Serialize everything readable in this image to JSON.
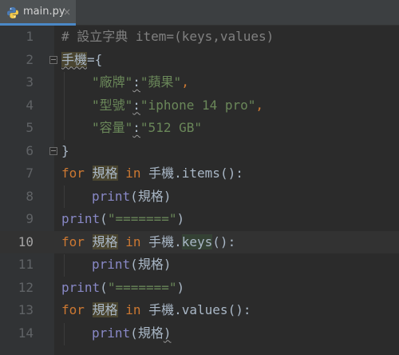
{
  "tab": {
    "filename": "main.py",
    "close_glyph": "×",
    "icon": "python-file-icon"
  },
  "editor": {
    "current_line": 10,
    "lines": [
      {
        "no": "1",
        "text": "# 設立字典 item=(keys,values)"
      },
      {
        "no": "2",
        "text": "手機={"
      },
      {
        "no": "3",
        "text": "\"廠牌\":\"蘋果\","
      },
      {
        "no": "4",
        "text": "\"型號\":\"iphone 14 pro\","
      },
      {
        "no": "5",
        "text": "\"容量\":\"512 GB\""
      },
      {
        "no": "6",
        "text": "}"
      },
      {
        "no": "7",
        "text": "for 規格 in 手機.items():"
      },
      {
        "no": "8",
        "text": "print(規格)"
      },
      {
        "no": "9",
        "text": "print(\"=======\")"
      },
      {
        "no": "10",
        "text": "for 規格 in 手機.keys():"
      },
      {
        "no": "11",
        "text": "print(規格)"
      },
      {
        "no": "12",
        "text": "print(\"=======\")"
      },
      {
        "no": "13",
        "text": "for 規格 in 手機.values():"
      },
      {
        "no": "14",
        "text": "print(規格)"
      }
    ]
  },
  "tokens": {
    "comment": "# 設立字典 item=(keys,values)",
    "var": "手機",
    "assign": "={",
    "close_brace": "}",
    "key_brand": "\"廠牌\"",
    "val_brand": "\"蘋果\"",
    "key_model": "\"型號\"",
    "val_model": "\"iphone 14 pro\"",
    "key_capacity": "\"容量\"",
    "val_capacity": "\"512 GB\"",
    "colon": ":",
    "comma": ",",
    "kw_for": "for",
    "kw_in": "in",
    "loop_var": "規格",
    "dot": ".",
    "m_items": "items",
    "m_keys": "keys",
    "m_values": "values",
    "call_colon": "():",
    "fn_print": "print",
    "lparen": "(",
    "rparen": ")",
    "sep_string": "\"=======\"",
    "space": " "
  }
}
